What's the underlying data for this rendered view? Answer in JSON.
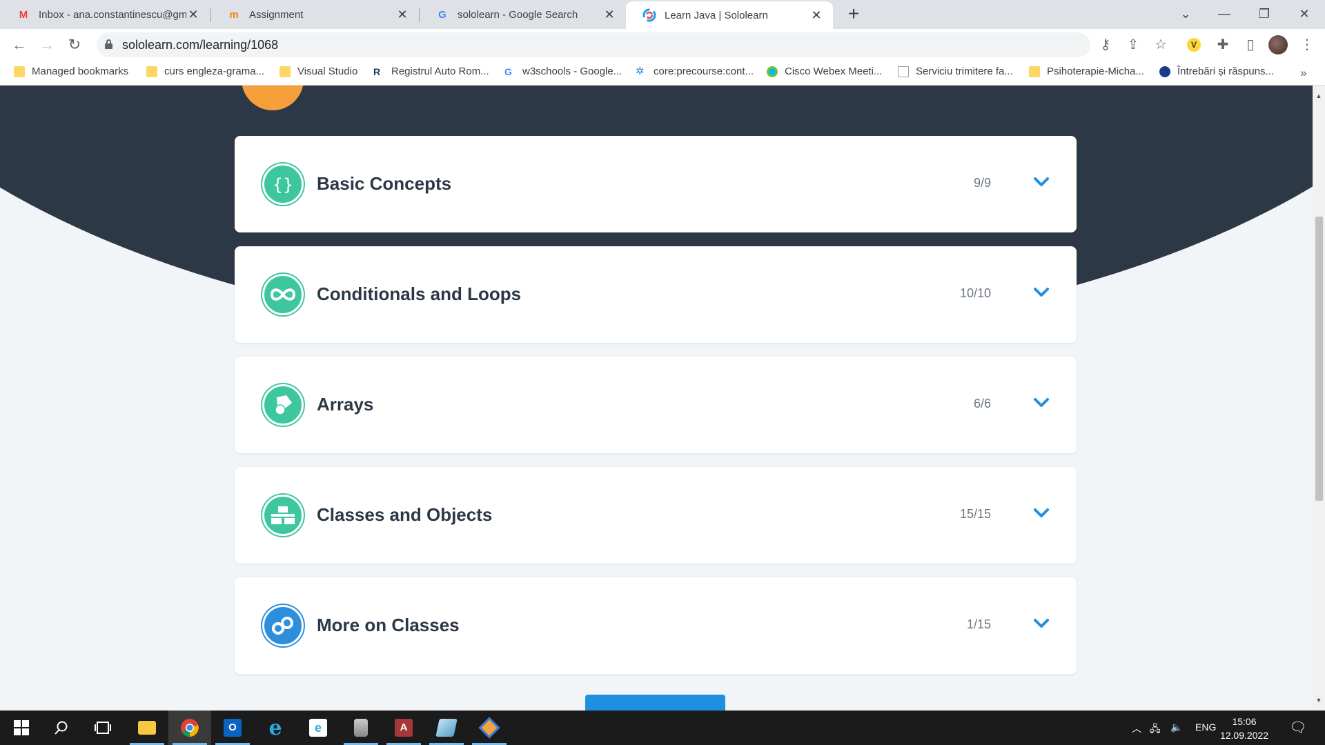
{
  "browser": {
    "tabs": [
      {
        "title": "Inbox - ana.constantinescu@gmail.com",
        "icon": "gmail-icon"
      },
      {
        "title": "Assignment",
        "icon": "moodle-icon"
      },
      {
        "title": "sololearn - Google Search",
        "icon": "google-icon"
      },
      {
        "title": "Learn Java | Sololearn",
        "icon": "sololearn-icon",
        "active": true
      }
    ],
    "new_tab_label": "+",
    "url": "sololearn.com/learning/1068"
  },
  "bookmarks": [
    {
      "label": "Managed bookmarks",
      "icon": "folder-icon"
    },
    {
      "label": "curs engleza-grama...",
      "icon": "folder-icon"
    },
    {
      "label": "Visual Studio",
      "icon": "folder-icon"
    },
    {
      "label": "Registrul Auto Rom...",
      "icon": "rar-icon"
    },
    {
      "label": "w3schools - Google...",
      "icon": "google-icon"
    },
    {
      "label": "core:precourse:cont...",
      "icon": "gear-icon"
    },
    {
      "label": "Cisco Webex Meeti...",
      "icon": "webex-icon"
    },
    {
      "label": "Serviciu trimitere fa...",
      "icon": "document-icon"
    },
    {
      "label": "Psihoterapie-Micha...",
      "icon": "folder-icon"
    },
    {
      "label": "Întrebări și răspuns...",
      "icon": "gov-icon"
    }
  ],
  "modules": [
    {
      "title": "Basic Concepts",
      "progress": "9/9",
      "icon": "braces-icon",
      "color": "#3ec79f"
    },
    {
      "title": "Conditionals and Loops",
      "progress": "10/10",
      "icon": "infinity-icon",
      "color": "#3ec79f"
    },
    {
      "title": "Arrays",
      "progress": "6/6",
      "icon": "shapes-icon",
      "color": "#3ec79f"
    },
    {
      "title": "Classes and Objects",
      "progress": "15/15",
      "icon": "blocks-icon",
      "color": "#3ec79f"
    },
    {
      "title": "More on Classes",
      "progress": "1/15",
      "icon": "rings-icon",
      "color": "#2d8fdc"
    }
  ],
  "colors": {
    "header_dark": "#2d3847",
    "accent_green": "#3ec79f",
    "accent_blue": "#2d8fdc",
    "chevron": "#1f8fe0"
  },
  "taskbar": {
    "language": "ENG",
    "time": "15:06",
    "date": "12.09.2022"
  }
}
